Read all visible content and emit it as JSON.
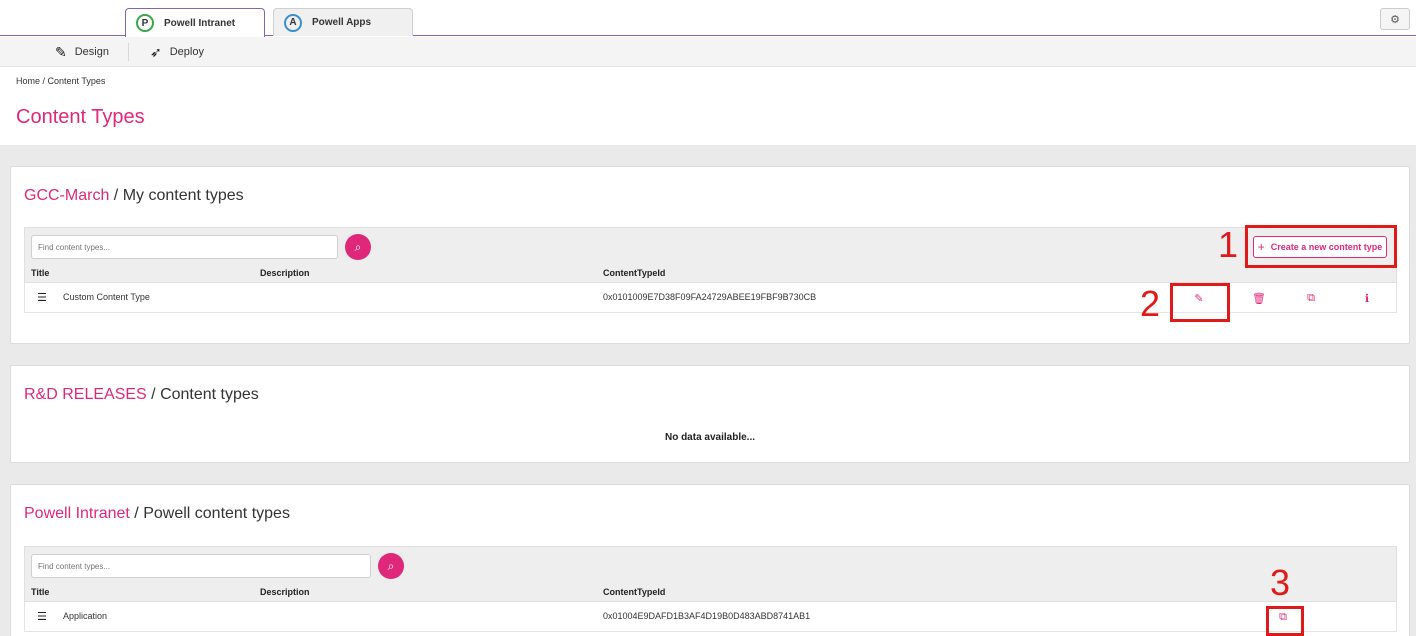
{
  "tabs": [
    {
      "label": "Powell Intranet",
      "logo": "P"
    },
    {
      "label": "Powell Apps",
      "logo": "A"
    }
  ],
  "subnav": {
    "design": "Design",
    "deploy": "Deploy"
  },
  "breadcrumb": "Home / Content Types",
  "page_title": "Content Types",
  "sections": [
    {
      "site": "GCC-March",
      "separator": " / ",
      "name": "My content types",
      "search_placeholder": "Find content types...",
      "create_label": "Create a new content type",
      "columns": {
        "title": "Title",
        "description": "Description",
        "id": "ContentTypeId"
      },
      "rows": [
        {
          "title": "Custom Content Type",
          "description": "",
          "id": "0x0101009E7D38F09FA24729ABEE19FBF9B730CB"
        }
      ]
    },
    {
      "site": "R&D RELEASES",
      "separator": " / ",
      "name": "Content types",
      "empty_text": "No data available..."
    },
    {
      "site": "Powell Intranet",
      "separator": " / ",
      "name": "Powell content types",
      "search_placeholder": "Find content types...",
      "columns": {
        "title": "Title",
        "description": "Description",
        "id": "ContentTypeId"
      },
      "rows": [
        {
          "title": "Application",
          "description": "",
          "id": "0x01004E9DAFD1B3AF4D19B0D483ABD8741AB1"
        }
      ]
    }
  ],
  "annotations": {
    "one": "1",
    "two": "2",
    "three": "3"
  },
  "colors": {
    "accent": "#e0287a",
    "annotation": "#e01919",
    "nav_border": "#8a64a8"
  },
  "icons": [
    "settings-gears-icon",
    "design-wand-icon",
    "deploy-rocket-icon",
    "search-icon",
    "list-icon",
    "edit-pencil-icon",
    "delete-trash-icon",
    "copy-icon",
    "info-icon"
  ]
}
